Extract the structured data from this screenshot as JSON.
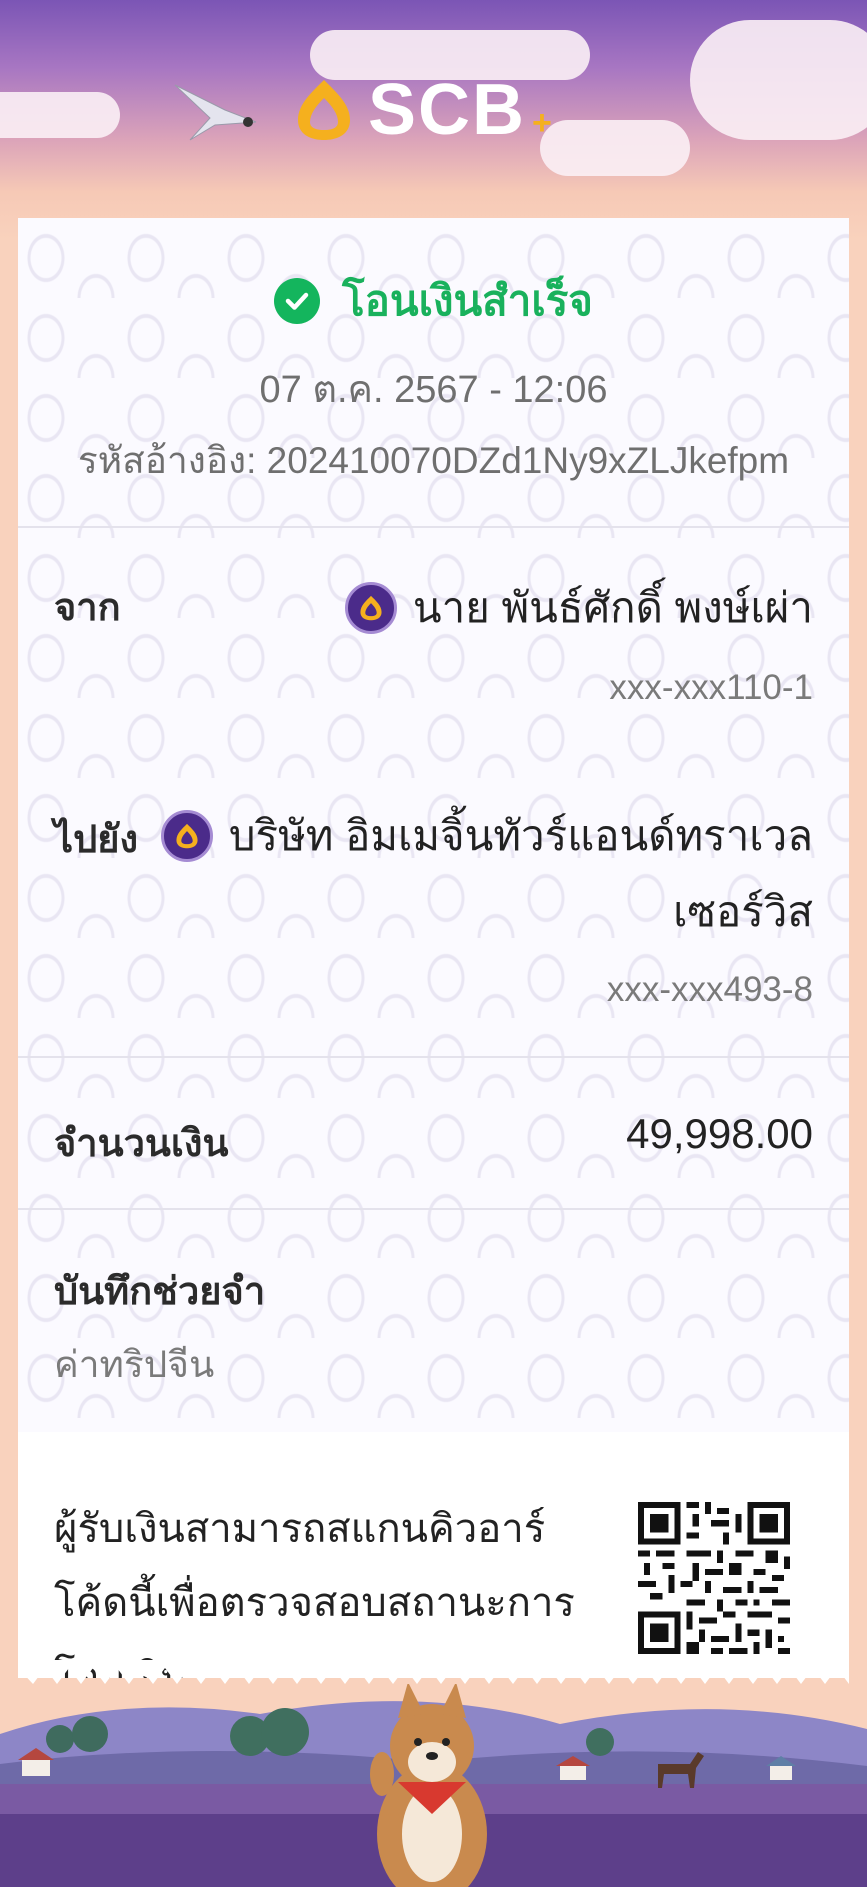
{
  "brand": {
    "name": "SCB",
    "plus": "+",
    "colors": {
      "purple": "#4b2b8a",
      "gold": "#f5b01e",
      "success": "#19b15c"
    }
  },
  "receipt": {
    "status": "โอนเงินสำเร็จ",
    "datetime": "07 ต.ค. 2567 - 12:06",
    "reference_label": "รหัสอ้างอิง:",
    "reference_value": "202410070DZd1Ny9xZLJkefpm",
    "from": {
      "label": "จาก",
      "name": "นาย พันธ์ศักดิ์ พงษ์เผ่า",
      "account": "xxx-xxx110-1"
    },
    "to": {
      "label": "ไปยัง",
      "name_line1": "บริษัท อิมเมจิ้นทัวร์แอนด์ทราเวล",
      "name_line2": "เซอร์วิส",
      "account": "xxx-xxx493-8"
    },
    "amount": {
      "label": "จำนวนเงิน",
      "value": "49,998.00"
    },
    "memo": {
      "label": "บันทึกช่วยจำ",
      "value": "ค่าทริปจีน"
    },
    "qr": {
      "line1": "ผู้รับเงินสามารถสแกนคิวอาร์",
      "line2": "โค้ดนี้เพื่อตรวจสอบสถานะการ",
      "line3": "โอนเงิน",
      "icon": "qr-code-icon"
    }
  }
}
